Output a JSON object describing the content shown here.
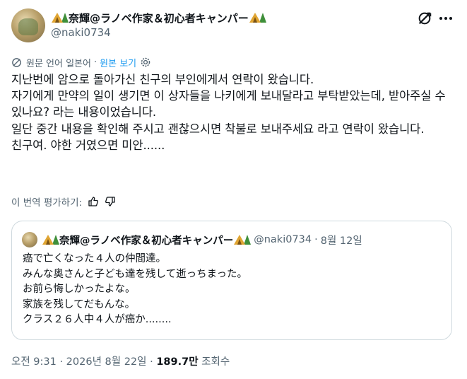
{
  "author": {
    "display_name": "奈輝@ラノベ作家＆初心者キャンパー",
    "handle": "@naki0734"
  },
  "translation": {
    "source_language": "원문 언어 일본어",
    "separator": "·",
    "show_original": "원본 보기"
  },
  "tweet": {
    "text": "지난번에 암으로 돌아가신 친구의 부인에게서 연락이 왔습니다.\n자기에게 만약의 일이 생기면 이 상자들을 나키에게 보내달라고 부탁받았는데, 받아주실 수 있나요? 라는 내용이었습니다.\n일단 중간 내용을 확인해 주시고 괜찮으시면 착불로 보내주세요 라고 연락이 왔습니다.\n친구여. 야한 거였으면 미안......"
  },
  "rate_translation": "이 번역 평가하기:",
  "quote": {
    "display_name": "奈輝@ラノベ作家＆初心者キャンパー",
    "handle": "@naki0734",
    "separator": "·",
    "date": "8월 12일",
    "text": "癌で亡くなった４人の仲間達。\nみんな奥さんと子ども達を残して逝っちまった。\nお前ら悔しかったよな。\n家族を残してだもんな。\nクラス２６人中４人が癌か........"
  },
  "meta": {
    "timestamp": "오전 9:31 · 2026년 8월 22일 · ",
    "views": "189.7만",
    "views_label": " 조회수"
  },
  "colors": {
    "accent": "#1d9bf0",
    "secondary_text": "#536471",
    "border": "#cfd9de"
  },
  "icons": [
    "grok-icon",
    "more-icon",
    "translate-icon",
    "gear-icon",
    "thumbs-up-icon",
    "thumbs-down-icon"
  ]
}
